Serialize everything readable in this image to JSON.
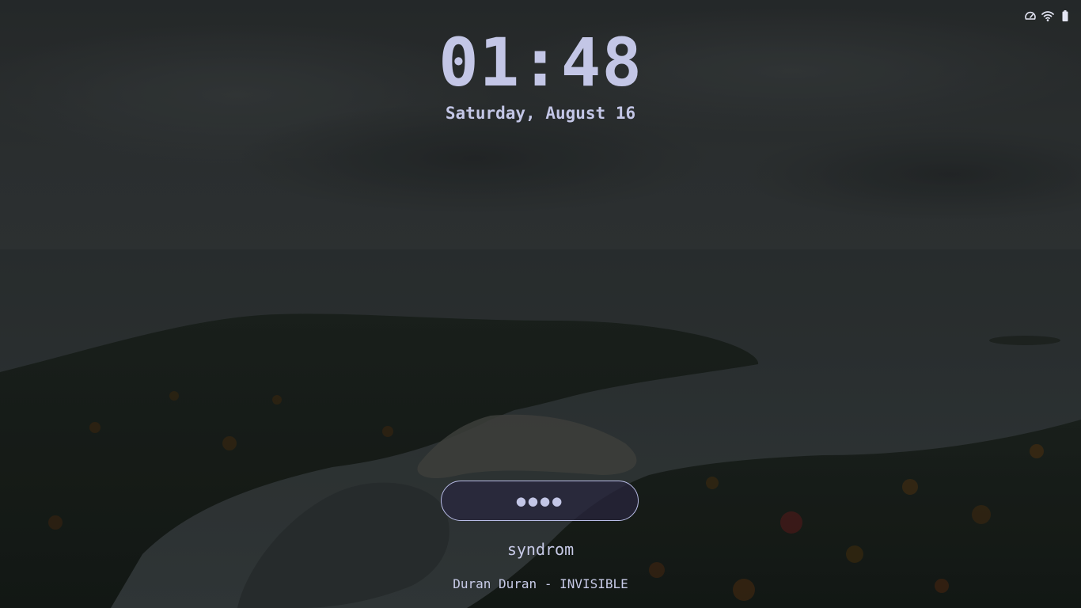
{
  "lock_screen": {
    "time": "01:48",
    "date": "Saturday, August 16",
    "password": {
      "masked_value": "●●●●"
    },
    "username": "syndrom",
    "now_playing": "Duran Duran - INVISIBLE"
  },
  "status_tray": {
    "icons": [
      "speedometer-icon",
      "wifi-icon",
      "battery-icon"
    ]
  },
  "colors": {
    "text": "#c3c6e6",
    "field_border": "#b8bce6",
    "field_background": "#28263e"
  }
}
